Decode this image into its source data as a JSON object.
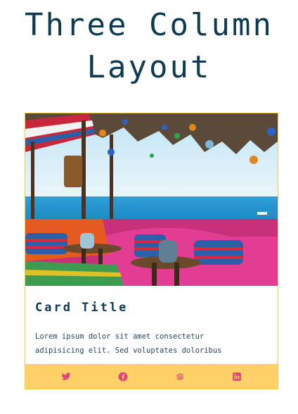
{
  "page": {
    "title": "Three Column Layout"
  },
  "card": {
    "image_subject": "outdoor seaside lounge with cushions, lanterns and blue sea",
    "title": "Card Title",
    "text": "Lorem ipsum dolor sit amet consectetur adipisicing elit. Sed voluptates doloribus"
  },
  "footer": {
    "icons": [
      "twitter-icon",
      "facebook-icon",
      "dribbble-icon",
      "linkedin-icon"
    ],
    "icon_color": "#e0447a",
    "background": "#ffd166"
  },
  "colors": {
    "heading": "#0f3b52",
    "card_border": "#f7c948"
  }
}
